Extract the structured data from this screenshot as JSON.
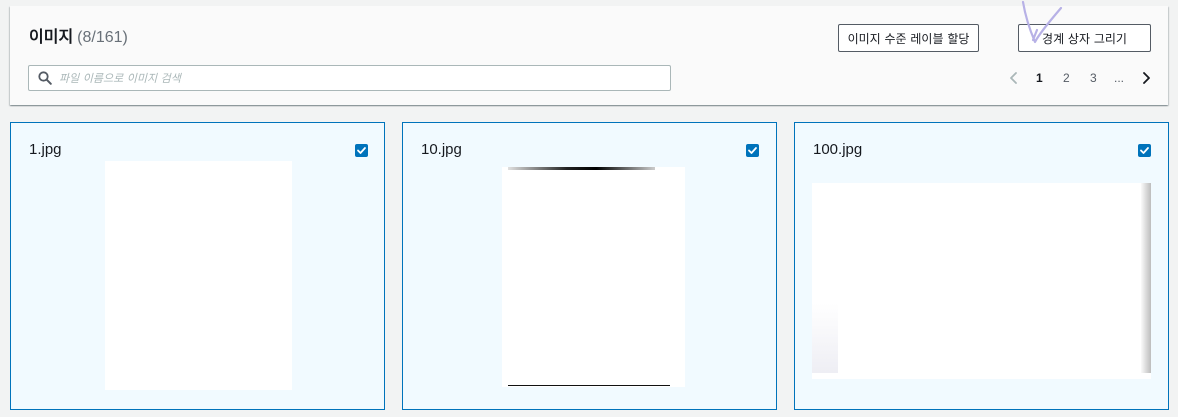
{
  "panel": {
    "title": "이미지",
    "count": "(8/161)"
  },
  "buttons": {
    "assign_label": "이미지 수준 레이블 할당",
    "draw_label": "경계 상자 그리기"
  },
  "search": {
    "placeholder": "파일 이름으로 이미지 검색",
    "value": ""
  },
  "pagination": {
    "pages": [
      "1",
      "2",
      "3",
      "..."
    ],
    "current": "1"
  },
  "cards": [
    {
      "filename": "1.jpg",
      "checked": true
    },
    {
      "filename": "10.jpg",
      "checked": true
    },
    {
      "filename": "100.jpg",
      "checked": true
    }
  ],
  "colors": {
    "accent": "#0073bb",
    "card_bg": "#f1faff",
    "page_bg": "#f2f3f3",
    "panel_bg": "#fafafa",
    "scribble": "#b7b1e6"
  },
  "icons": {
    "search": "search-icon",
    "prev": "chevron-left-icon",
    "next": "chevron-right-icon",
    "check": "checkmark-icon"
  }
}
